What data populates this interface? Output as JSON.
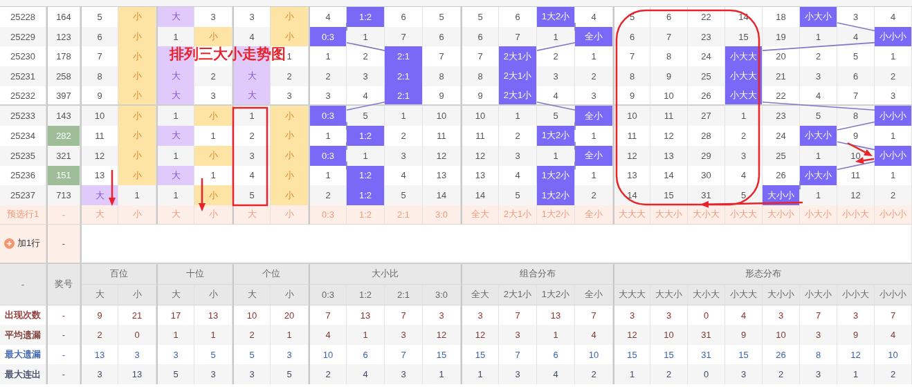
{
  "annotation_title": "排列三大小走势图",
  "rows": [
    {
      "period": "25228",
      "number": "164",
      "highlight": false,
      "cells": [
        {
          "t": "5",
          "hit": false
        },
        {
          "t": "小",
          "hit": true
        },
        {
          "t": "大",
          "hit": true
        },
        {
          "t": "3",
          "hit": false
        },
        {
          "t": "3",
          "hit": false
        },
        {
          "t": "小",
          "hit": true
        },
        {
          "t": "4",
          "hit": false
        },
        {
          "t": "1:2",
          "hit": true
        },
        {
          "t": "6",
          "hit": false
        },
        {
          "t": "5",
          "hit": false
        },
        {
          "t": "5",
          "hit": false
        },
        {
          "t": "6",
          "hit": false
        },
        {
          "t": "1大2小",
          "hit": true
        },
        {
          "t": "4",
          "hit": false
        },
        {
          "t": "5",
          "hit": false
        },
        {
          "t": "6",
          "hit": false
        },
        {
          "t": "22",
          "hit": false
        },
        {
          "t": "14",
          "hit": false
        },
        {
          "t": "18",
          "hit": false
        },
        {
          "t": "小大小",
          "hit": true
        },
        {
          "t": "3",
          "hit": false
        },
        {
          "t": "4",
          "hit": false
        }
      ]
    },
    {
      "period": "25229",
      "number": "123",
      "highlight": false,
      "cells": [
        {
          "t": "6",
          "hit": false
        },
        {
          "t": "小",
          "hit": true
        },
        {
          "t": "1",
          "hit": false
        },
        {
          "t": "小",
          "hit": true
        },
        {
          "t": "4",
          "hit": false
        },
        {
          "t": "小",
          "hit": true
        },
        {
          "t": "0:3",
          "hit": true
        },
        {
          "t": "1",
          "hit": false
        },
        {
          "t": "7",
          "hit": false
        },
        {
          "t": "6",
          "hit": false
        },
        {
          "t": "6",
          "hit": false
        },
        {
          "t": "7",
          "hit": false
        },
        {
          "t": "1",
          "hit": false
        },
        {
          "t": "全小",
          "hit": true
        },
        {
          "t": "6",
          "hit": false
        },
        {
          "t": "7",
          "hit": false
        },
        {
          "t": "23",
          "hit": false
        },
        {
          "t": "15",
          "hit": false
        },
        {
          "t": "19",
          "hit": false
        },
        {
          "t": "1",
          "hit": false
        },
        {
          "t": "4",
          "hit": false
        },
        {
          "t": "小小小",
          "hit": true
        }
      ]
    },
    {
      "period": "25230",
      "number": "178",
      "highlight": false,
      "cells": [
        {
          "t": "7",
          "hit": false
        },
        {
          "t": "小",
          "hit": true
        },
        {
          "hit": true
        },
        {
          "hit": false
        },
        {
          "hit": true
        },
        {
          "t": "1",
          "hit": false
        },
        {
          "t": "1",
          "hit": false
        },
        {
          "t": "2",
          "hit": false
        },
        {
          "t": "2:1",
          "hit": true
        },
        {
          "t": "7",
          "hit": false
        },
        {
          "t": "7",
          "hit": false
        },
        {
          "t": "2大1小",
          "hit": true
        },
        {
          "t": "2",
          "hit": false
        },
        {
          "t": "1",
          "hit": false
        },
        {
          "t": "7",
          "hit": false
        },
        {
          "t": "8",
          "hit": false
        },
        {
          "t": "24",
          "hit": false
        },
        {
          "t": "小大大",
          "hit": true
        },
        {
          "t": "20",
          "hit": false
        },
        {
          "t": "2",
          "hit": false
        },
        {
          "t": "5",
          "hit": false
        },
        {
          "t": "1",
          "hit": false
        }
      ]
    },
    {
      "period": "25231",
      "number": "258",
      "highlight": false,
      "cells": [
        {
          "t": "8",
          "hit": false
        },
        {
          "t": "小",
          "hit": true
        },
        {
          "t": "大",
          "hit": true
        },
        {
          "t": "2",
          "hit": false
        },
        {
          "t": "大",
          "hit": true
        },
        {
          "t": "2",
          "hit": false
        },
        {
          "t": "2",
          "hit": false
        },
        {
          "t": "3",
          "hit": false
        },
        {
          "t": "2:1",
          "hit": true
        },
        {
          "t": "8",
          "hit": false
        },
        {
          "t": "8",
          "hit": false
        },
        {
          "t": "2大1小",
          "hit": true
        },
        {
          "t": "3",
          "hit": false
        },
        {
          "t": "2",
          "hit": false
        },
        {
          "t": "8",
          "hit": false
        },
        {
          "t": "9",
          "hit": false
        },
        {
          "t": "25",
          "hit": false
        },
        {
          "t": "小大大",
          "hit": true
        },
        {
          "t": "21",
          "hit": false
        },
        {
          "t": "3",
          "hit": false
        },
        {
          "t": "6",
          "hit": false
        },
        {
          "t": "2",
          "hit": false
        }
      ]
    },
    {
      "period": "25232",
      "number": "397",
      "highlight": false,
      "cells": [
        {
          "t": "9",
          "hit": false
        },
        {
          "t": "小",
          "hit": true
        },
        {
          "t": "大",
          "hit": true
        },
        {
          "t": "3",
          "hit": false
        },
        {
          "t": "大",
          "hit": true
        },
        {
          "t": "3",
          "hit": false
        },
        {
          "t": "3",
          "hit": false
        },
        {
          "t": "4",
          "hit": false
        },
        {
          "t": "2:1",
          "hit": true
        },
        {
          "t": "9",
          "hit": false
        },
        {
          "t": "9",
          "hit": false
        },
        {
          "t": "2大1小",
          "hit": true
        },
        {
          "t": "4",
          "hit": false
        },
        {
          "t": "3",
          "hit": false
        },
        {
          "t": "9",
          "hit": false
        },
        {
          "t": "10",
          "hit": false
        },
        {
          "t": "26",
          "hit": false
        },
        {
          "t": "小大大",
          "hit": true
        },
        {
          "t": "22",
          "hit": false
        },
        {
          "t": "4",
          "hit": false
        },
        {
          "t": "7",
          "hit": false
        },
        {
          "t": "3",
          "hit": false
        }
      ]
    },
    {
      "period": "25233",
      "number": "143",
      "highlight": false,
      "cells": [
        {
          "t": "10",
          "hit": false
        },
        {
          "t": "小",
          "hit": true
        },
        {
          "t": "1",
          "hit": false
        },
        {
          "t": "小",
          "hit": true
        },
        {
          "t": "1",
          "hit": false
        },
        {
          "t": "小",
          "hit": true
        },
        {
          "t": "0:3",
          "hit": true
        },
        {
          "t": "5",
          "hit": false
        },
        {
          "t": "1",
          "hit": false
        },
        {
          "t": "10",
          "hit": false
        },
        {
          "t": "10",
          "hit": false
        },
        {
          "t": "1",
          "hit": false
        },
        {
          "t": "5",
          "hit": false
        },
        {
          "t": "全小",
          "hit": true
        },
        {
          "t": "10",
          "hit": false
        },
        {
          "t": "11",
          "hit": false
        },
        {
          "t": "27",
          "hit": false
        },
        {
          "t": "1",
          "hit": false
        },
        {
          "t": "23",
          "hit": false
        },
        {
          "t": "5",
          "hit": false
        },
        {
          "t": "8",
          "hit": false
        },
        {
          "t": "小小小",
          "hit": true
        }
      ]
    },
    {
      "period": "25234",
      "number": "282",
      "highlight": true,
      "cells": [
        {
          "t": "11",
          "hit": false
        },
        {
          "t": "小",
          "hit": true
        },
        {
          "t": "大",
          "hit": true
        },
        {
          "t": "1",
          "hit": false
        },
        {
          "t": "2",
          "hit": false
        },
        {
          "t": "小",
          "hit": true
        },
        {
          "t": "1",
          "hit": false
        },
        {
          "t": "1:2",
          "hit": true
        },
        {
          "t": "2",
          "hit": false
        },
        {
          "t": "11",
          "hit": false
        },
        {
          "t": "11",
          "hit": false
        },
        {
          "t": "2",
          "hit": false
        },
        {
          "t": "1大2小",
          "hit": true
        },
        {
          "t": "1",
          "hit": false
        },
        {
          "t": "11",
          "hit": false
        },
        {
          "t": "12",
          "hit": false
        },
        {
          "t": "28",
          "hit": false
        },
        {
          "t": "2",
          "hit": false
        },
        {
          "t": "24",
          "hit": false
        },
        {
          "t": "小大小",
          "hit": true
        },
        {
          "t": "9",
          "hit": false
        },
        {
          "t": "1",
          "hit": false
        }
      ]
    },
    {
      "period": "25235",
      "number": "321",
      "highlight": false,
      "cells": [
        {
          "t": "12",
          "hit": false
        },
        {
          "t": "小",
          "hit": true
        },
        {
          "t": "1",
          "hit": false
        },
        {
          "t": "小",
          "hit": true
        },
        {
          "t": "3",
          "hit": false
        },
        {
          "t": "小",
          "hit": true
        },
        {
          "t": "0:3",
          "hit": true
        },
        {
          "t": "1",
          "hit": false
        },
        {
          "t": "3",
          "hit": false
        },
        {
          "t": "12",
          "hit": false
        },
        {
          "t": "12",
          "hit": false
        },
        {
          "t": "3",
          "hit": false
        },
        {
          "t": "1",
          "hit": false
        },
        {
          "t": "全小",
          "hit": true
        },
        {
          "t": "12",
          "hit": false
        },
        {
          "t": "13",
          "hit": false
        },
        {
          "t": "29",
          "hit": false
        },
        {
          "t": "3",
          "hit": false
        },
        {
          "t": "25",
          "hit": false
        },
        {
          "t": "1",
          "hit": false
        },
        {
          "t": "10",
          "hit": false
        },
        {
          "t": "小小小",
          "hit": true
        }
      ]
    },
    {
      "period": "25236",
      "number": "151",
      "highlight": true,
      "cells": [
        {
          "t": "13",
          "hit": false
        },
        {
          "t": "小",
          "hit": true
        },
        {
          "t": "大",
          "hit": true
        },
        {
          "t": "1",
          "hit": false
        },
        {
          "t": "4",
          "hit": false
        },
        {
          "t": "小",
          "hit": true
        },
        {
          "t": "1",
          "hit": false
        },
        {
          "t": "1:2",
          "hit": true
        },
        {
          "t": "4",
          "hit": false
        },
        {
          "t": "13",
          "hit": false
        },
        {
          "t": "13",
          "hit": false
        },
        {
          "t": "4",
          "hit": false
        },
        {
          "t": "1大2小",
          "hit": true
        },
        {
          "t": "1",
          "hit": false
        },
        {
          "t": "13",
          "hit": false
        },
        {
          "t": "14",
          "hit": false
        },
        {
          "t": "30",
          "hit": false
        },
        {
          "t": "4",
          "hit": false
        },
        {
          "t": "26",
          "hit": false
        },
        {
          "t": "小大小",
          "hit": true
        },
        {
          "t": "11",
          "hit": false
        },
        {
          "t": "1",
          "hit": false
        }
      ]
    },
    {
      "period": "25237",
      "number": "713",
      "highlight": false,
      "cells": [
        {
          "t": "大",
          "hit": true
        },
        {
          "t": "1",
          "hit": false
        },
        {
          "t": "1",
          "hit": false
        },
        {
          "t": "小",
          "hit": true
        },
        {
          "t": "5",
          "hit": false
        },
        {
          "t": "小",
          "hit": true
        },
        {
          "t": "2",
          "hit": false
        },
        {
          "t": "1:2",
          "hit": true
        },
        {
          "t": "5",
          "hit": false
        },
        {
          "t": "14",
          "hit": false
        },
        {
          "t": "14",
          "hit": false
        },
        {
          "t": "5",
          "hit": false
        },
        {
          "t": "1大2小",
          "hit": true
        },
        {
          "t": "2",
          "hit": false
        },
        {
          "t": "14",
          "hit": false
        },
        {
          "t": "15",
          "hit": false
        },
        {
          "t": "31",
          "hit": false
        },
        {
          "t": "5",
          "hit": false
        },
        {
          "t": "大小小",
          "hit": true
        },
        {
          "t": "1",
          "hit": false
        },
        {
          "t": "12",
          "hit": false
        },
        {
          "t": "2",
          "hit": false
        }
      ]
    }
  ],
  "preselect": {
    "label": "预选行1",
    "number": "-",
    "options": [
      "大",
      "小",
      "大",
      "小",
      "大",
      "小",
      "0:3",
      "1:2",
      "2:1",
      "3:0",
      "全大",
      "2大1小",
      "1大2小",
      "全小",
      "大大大",
      "大大小",
      "大小大",
      "小大大",
      "大小小",
      "小大小",
      "小小大",
      "小小小"
    ]
  },
  "add_row": {
    "label": "加1行",
    "number": "-"
  },
  "stats_header": {
    "corner": "-",
    "number": "奖号",
    "groups": [
      {
        "label": "百位",
        "columns": [
          "大",
          "小"
        ]
      },
      {
        "label": "十位",
        "columns": [
          "大",
          "小"
        ]
      },
      {
        "label": "个位",
        "columns": [
          "大",
          "小"
        ]
      },
      {
        "label": "大小比",
        "columns": [
          "0:3",
          "1:2",
          "2:1",
          "3:0"
        ]
      },
      {
        "label": "组合分布",
        "columns": [
          "全大",
          "2大1小",
          "1大2小",
          "全小"
        ]
      },
      {
        "label": "形态分布",
        "columns": [
          "大大大",
          "大大小",
          "大小大",
          "小大大",
          "大小小",
          "小大小",
          "小小大",
          "小小小"
        ]
      }
    ]
  },
  "stats": [
    {
      "label": "出现次数",
      "number": "-",
      "color": "#8f2f2f",
      "values": [
        "9",
        "21",
        "17",
        "13",
        "10",
        "20",
        "7",
        "13",
        "7",
        "3",
        "3",
        "7",
        "13",
        "7",
        "3",
        "3",
        "0",
        "4",
        "3",
        "7",
        "3",
        "7"
      ]
    },
    {
      "label": "平均遗漏",
      "number": "-",
      "color": "#7d3a32",
      "values": [
        "2",
        "0",
        "1",
        "1",
        "2",
        "1",
        "4",
        "1",
        "3",
        "12",
        "12",
        "3",
        "1",
        "4",
        "12",
        "10",
        "31",
        "9",
        "10",
        "3",
        "9",
        "4"
      ]
    },
    {
      "label": "最大遗漏",
      "number": "-",
      "color": "#3a62ad",
      "values": [
        "13",
        "3",
        "3",
        "5",
        "5",
        "3",
        "10",
        "6",
        "7",
        "15",
        "15",
        "7",
        "6",
        "10",
        "15",
        "15",
        "31",
        "15",
        "26",
        "8",
        "12",
        "10"
      ]
    },
    {
      "label": "最大连出",
      "number": "-",
      "color": "#3f4a66",
      "values": [
        "3",
        "13",
        "5",
        "3",
        "3",
        "5",
        "2",
        "4",
        "3",
        "1",
        "1",
        "3",
        "4",
        "2",
        "1",
        "2",
        "0",
        "3",
        "2",
        "3",
        "1",
        "2"
      ]
    }
  ]
}
